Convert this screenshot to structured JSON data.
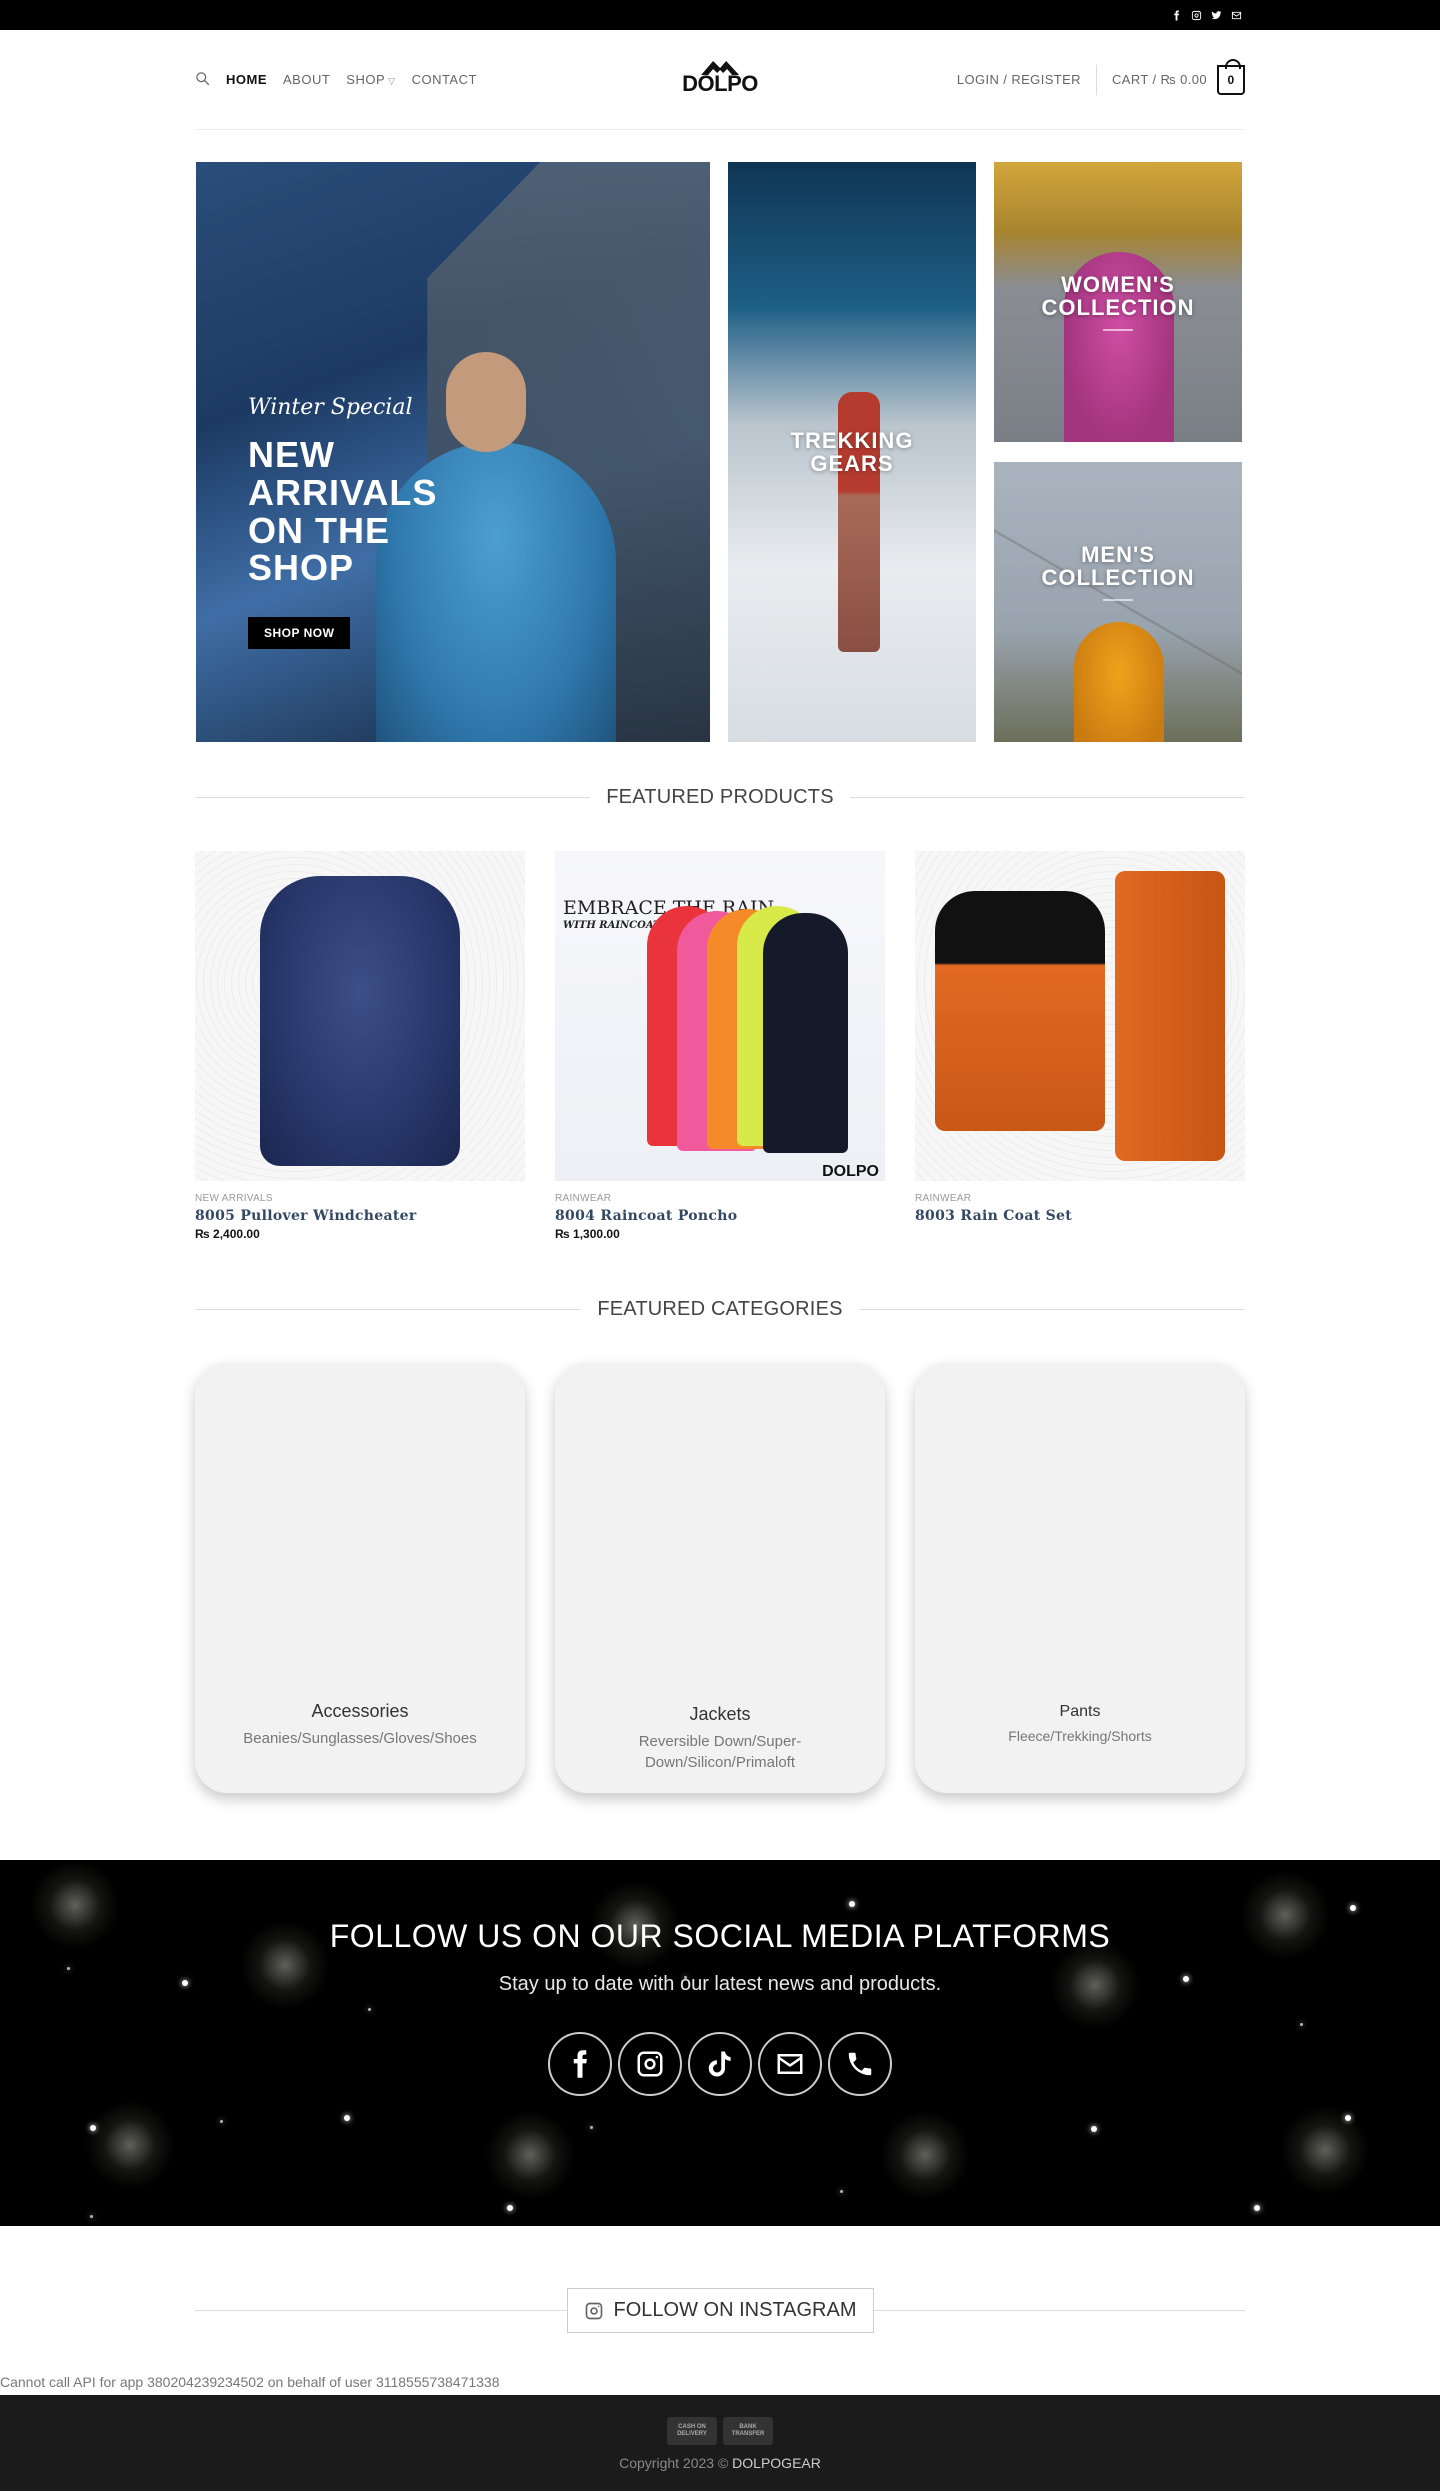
{
  "topbar": {
    "icons": [
      "facebook-icon",
      "instagram-icon",
      "twitter-icon",
      "envelope-icon"
    ]
  },
  "header": {
    "nav": {
      "home": "HOME",
      "about": "ABOUT",
      "shop": "SHOP",
      "contact": "CONTACT"
    },
    "logo_text": "DOLPO",
    "login": "LOGIN / REGISTER",
    "cart_label": "CART / ₨ 0.00",
    "cart_count": "0"
  },
  "hero": {
    "main": {
      "script": "Winter Special",
      "line1": "NEW",
      "line2": "ARRIVALS",
      "line3": "ON THE",
      "line4": "SHOP",
      "button": "SHOP NOW"
    },
    "trekking": {
      "line1": "TREKKING",
      "line2": "GEARS"
    },
    "women": {
      "line1": "WOMEN'S",
      "line2": "COLLECTION"
    },
    "men": {
      "line1": "MEN'S",
      "line2": "COLLECTION"
    }
  },
  "featured_products": {
    "title": "FEATURED PRODUCTS",
    "items": [
      {
        "category": "NEW ARRIVALS",
        "name": "8005 Pullover Windcheater",
        "price": "₨ 2,400.00"
      },
      {
        "category": "RAINWEAR",
        "name": "8004 Raincoat Poncho",
        "price": "₨ 1,300.00",
        "image_text": "EMBRACE THE RAIN",
        "image_subtext": "WITH RAINCOAT (PONCHO)",
        "image_logo": "DOLPO"
      },
      {
        "category": "RAINWEAR",
        "name": "8003 Rain Coat Set",
        "price": ""
      }
    ]
  },
  "featured_categories": {
    "title": "FEATURED CATEGORIES",
    "items": [
      {
        "name": "Accessories",
        "desc": "Beanies/Sunglasses/Gloves/Shoes"
      },
      {
        "name": "Jackets",
        "desc": "Reversible Down/Super-Down/Silicon/Primaloft"
      },
      {
        "name": "Pants",
        "desc": "Fleece/Trekking/Shorts"
      }
    ]
  },
  "social": {
    "heading": "FOLLOW US ON OUR SOCIAL MEDIA PLATFORMS",
    "subheading": "Stay up to date with our latest news and products.",
    "icons": [
      "facebook-icon",
      "instagram-icon",
      "tiktok-icon",
      "envelope-icon",
      "phone-icon"
    ]
  },
  "instagram": {
    "label": "FOLLOW ON INSTAGRAM"
  },
  "api_error": "Cannot call API for app 380204239234502 on behalf of user 3118555738471338",
  "footer": {
    "payment1": "CASH ON DELIVERY",
    "payment2": "BANK TRANSFER",
    "copyright_prefix": "Copyright 2023 ©",
    "brand": "DOLPOGEAR"
  },
  "colors": {
    "accent_link": "#334862",
    "dark": "#000000",
    "footer_bg": "#1b1b1b"
  }
}
